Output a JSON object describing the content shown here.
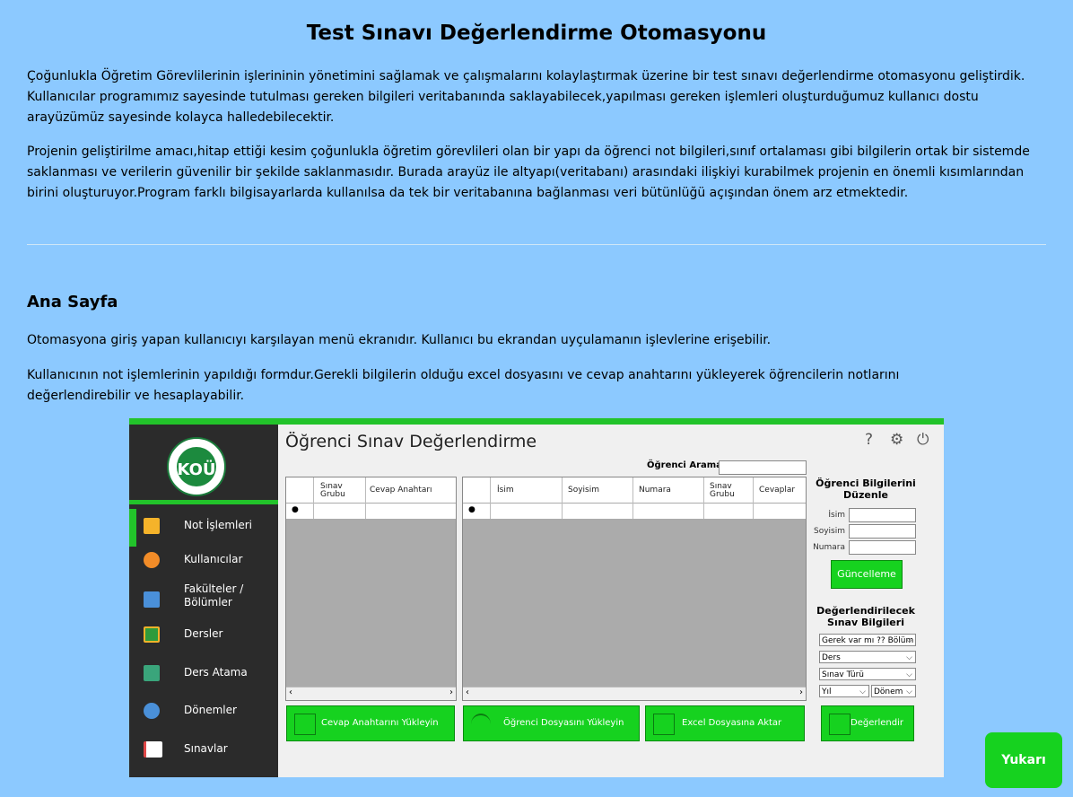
{
  "page": {
    "title": "Test Sınavı Değerlendirme Otomasyonu",
    "intro_p1": "Çoğunlukla Öğretim Görevlilerinin işlerininin yönetimini sağlamak ve çalışmalarını kolaylaştırmak üzerine bir test sınavı değerlendirme otomasyonu geliştirdik. Kullanıcılar programımız sayesinde tutulması gereken bilgileri veritabanında saklayabilecek,yapılması gereken işlemleri oluşturduğumuz kullanıcı dostu arayüzümüz sayesinde kolayca halledebilecektir.",
    "intro_p2": "Projenin geliştirilme amacı,hitap ettiği kesim çoğunlukla öğretim görevlileri olan bir yapı da öğrenci not bilgileri,sınıf ortalaması gibi bilgilerin ortak bir sistemde saklanması ve verilerin güvenilir bir şekilde saklanmasıdır. Burada arayüz ile altyapı(veritabanı) arasındaki ilişkiyi kurabilmek projenin en önemli kısımlarından birini oluşturuyor.Program farklı bilgisayarlarda kullanılsa da tek bir veritabanına bağlanması veri bütünlüğü açışından önem arz etmektedir.",
    "section_title": "Ana Sayfa",
    "section_p1": "Otomasyona giriş yapan kullanıcıyı karşılayan menü ekranıdır. Kullanıcı bu ekrandan uyçulamanın işlevlerine erişebilir.",
    "section_p2": "Kullanıcının not işlemlerinin yapıldığı formdur.Gerekli bilgilerin olduğu excel dosyasını ve cevap anahtarını yükleyerek öğrencilerin notlarını değerlendirebilir ve hesaplayabilir.",
    "up_button": "Yukarı"
  },
  "app": {
    "title": "Öğrenci Sınav Değerlendirme",
    "logo_text": "KOÜ",
    "menu": [
      {
        "label": "Not İşlemleri",
        "icon": "note-icon",
        "color": "#f5b32a"
      },
      {
        "label": "Kullanıcılar",
        "icon": "users-icon",
        "color": "#f28c28"
      },
      {
        "label": "Fakülteler / Bölümler",
        "icon": "building-icon",
        "color": "#4a90d9"
      },
      {
        "label": "Dersler",
        "icon": "board-icon",
        "color": "#2e9b3c"
      },
      {
        "label": "Ders Atama",
        "icon": "teacher-icon",
        "color": "#3aa57b"
      },
      {
        "label": "Dönemler",
        "icon": "clock-icon",
        "color": "#4a90d9"
      },
      {
        "label": "Sınavlar",
        "icon": "exam-icon",
        "color": "#e04848"
      }
    ],
    "search_label": "Öğrenci Arama",
    "grid1_cols": [
      "Sınav Grubu",
      "Cevap Anahtarı"
    ],
    "grid2_cols": [
      "İsim",
      "Soyisim",
      "Numara",
      "Sınav Grubu",
      "Cevaplar"
    ],
    "edit_title": "Öğrenci Bilgilerini Düzenle",
    "edit_labels": [
      "İsim",
      "Soyisim",
      "Numara"
    ],
    "update_button": "Güncelleme",
    "exam_info_title": "Değerlendirilecek Sınav Bilgileri",
    "selects": [
      "Gerek var mı ?? Bölüm",
      "Ders",
      "Sınav Türü",
      "Yıl",
      "Dönem"
    ],
    "buttons": {
      "upload_key": "Cevap Anahtarını Yükleyin",
      "upload_students": "Öğrenci Dosyasını Yükleyin",
      "export_excel": "Excel Dosyasına Aktar",
      "evaluate": "Değerlendir"
    }
  }
}
